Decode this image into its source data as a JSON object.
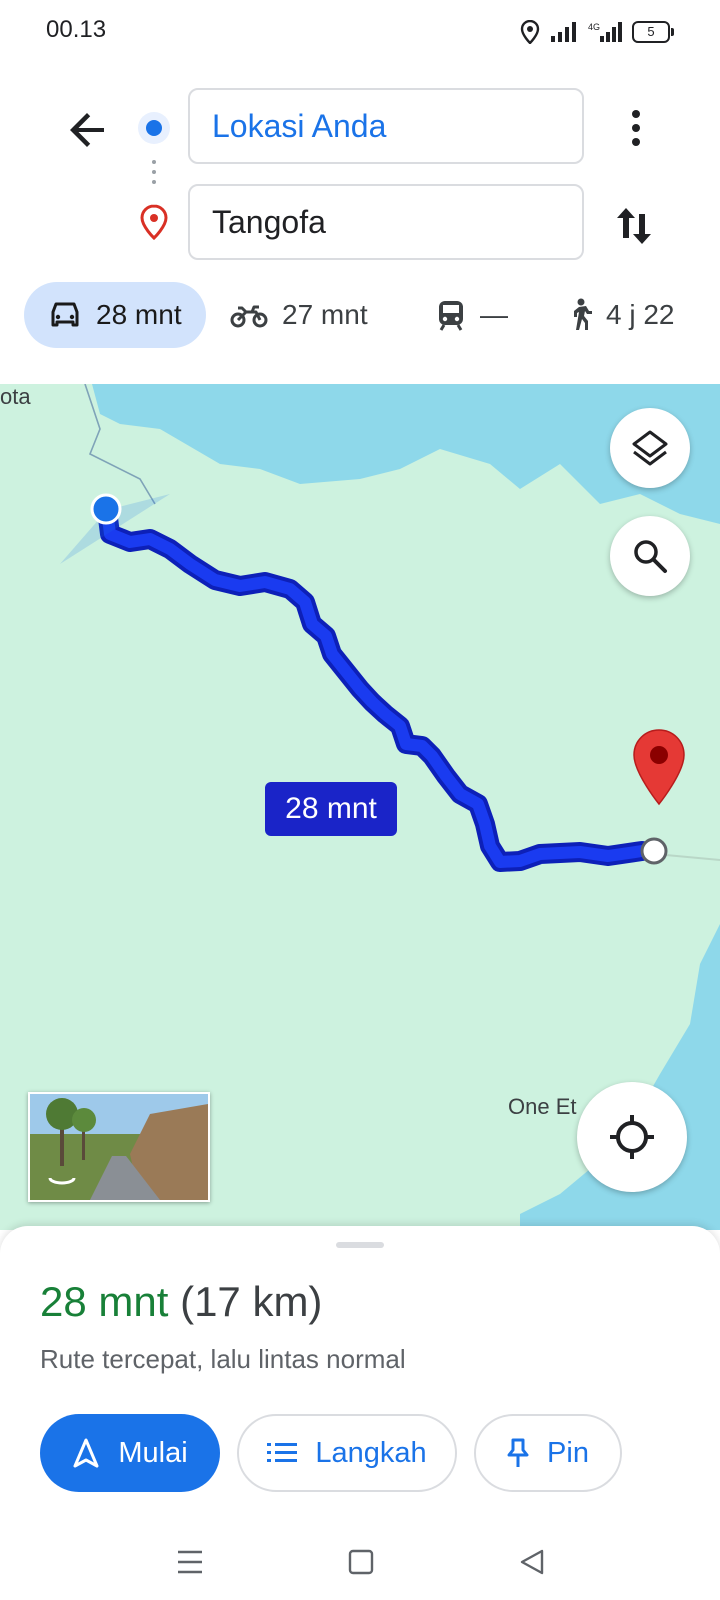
{
  "status_bar": {
    "time": "00.13",
    "battery": "5",
    "network": "4G"
  },
  "directions": {
    "origin_value": "Lokasi Anda",
    "destination_value": "Tangofa"
  },
  "travel_modes": [
    {
      "name": "car",
      "label": "28 mnt",
      "selected": true
    },
    {
      "name": "motorcycle",
      "label": "27 mnt",
      "selected": false
    },
    {
      "name": "transit",
      "label": "—",
      "selected": false
    },
    {
      "name": "walking",
      "label": "4 j 22",
      "selected": false
    }
  ],
  "map": {
    "place_labels": [
      "ota",
      "One Et"
    ],
    "route_eta_label": "28 mnt",
    "colors": {
      "land": "#cdf2df",
      "water": "#8ed8ea",
      "route": "#1a3bf0",
      "route_outline": "#0d20b8",
      "dest_marker": "#e53935",
      "eta_bubble": "#1a24c8"
    }
  },
  "route_summary": {
    "duration": "28 mnt",
    "distance": "(17 km)",
    "description": "Rute tercepat, lalu lintas normal"
  },
  "actions": {
    "start_label": "Mulai",
    "steps_label": "Langkah",
    "pin_label": "Pin"
  },
  "icons": [
    "back-arrow-icon",
    "more-vert-icon",
    "swap-icon",
    "car-icon",
    "motorcycle-icon",
    "train-icon",
    "walk-icon",
    "layers-icon",
    "search-icon",
    "my-location-icon",
    "navigation-icon",
    "list-icon",
    "pin-icon"
  ],
  "accent_colors": {
    "primary": "#1a73e8",
    "duration_green": "#188038",
    "mode_selected_bg": "#d2e3fc"
  }
}
